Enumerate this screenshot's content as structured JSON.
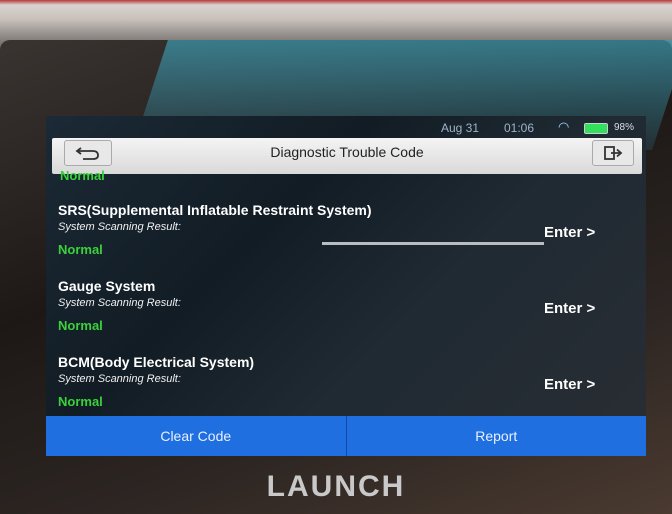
{
  "status_bar": {
    "date": "Aug 31",
    "time": "01:06",
    "battery": "98%",
    "battery_fill": 0.98,
    "wifi_icon": "wifi-icon"
  },
  "title_bar": {
    "title": "Diagnostic Trouble Code",
    "back_icon": "back-arrow-icon",
    "exit_icon": "exit-icon"
  },
  "list": {
    "partial_status": "Normal",
    "items": [
      {
        "name": "SRS(Supplemental Inflatable Restraint System)",
        "subtitle": "System Scanning Result:",
        "status": "Normal",
        "action": "Enter >"
      },
      {
        "name": "Gauge System",
        "subtitle": "System Scanning Result:",
        "status": "Normal",
        "action": "Enter >"
      },
      {
        "name": "BCM(Body Electrical System)",
        "subtitle": "System Scanning Result:",
        "status": "Normal",
        "action": "Enter >"
      }
    ]
  },
  "bottom_bar": {
    "clear_code": "Clear Code",
    "report": "Report"
  },
  "device": {
    "brand": "LAUNCH"
  },
  "colors": {
    "status_normal": "#3ad23a",
    "button_blue": "#1f6fe0"
  }
}
